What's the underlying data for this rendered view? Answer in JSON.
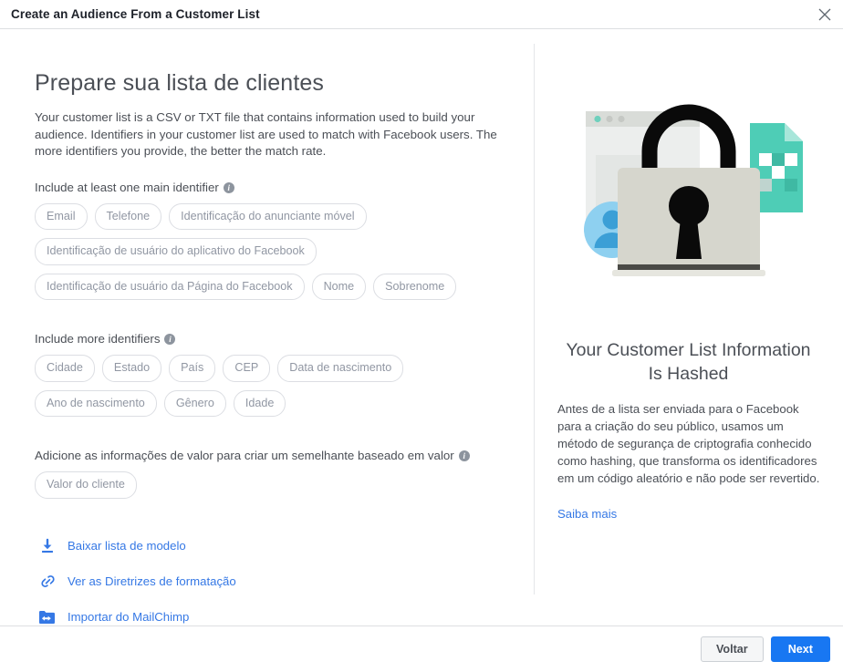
{
  "header": {
    "title": "Create an Audience From a Customer List",
    "close_icon": "close-icon"
  },
  "left": {
    "heading": "Prepare sua lista de clientes",
    "intro": "Your customer list is a CSV or TXT file that contains information used to build your audience. Identifiers in your customer list are used to match with Facebook users. The more identifiers you provide, the better the match rate.",
    "main_identifiers_label": "Include at least one main identifier",
    "main_identifiers": [
      "Email",
      "Telefone",
      "Identificação do anunciante móvel",
      "Identificação de usuário do aplicativo do Facebook",
      "Identificação de usuário da Página do Facebook",
      "Nome",
      "Sobrenome"
    ],
    "more_identifiers_label": "Include more identifiers",
    "more_identifiers": [
      "Cidade",
      "Estado",
      "País",
      "CEP",
      "Data de nascimento",
      "Ano de nascimento",
      "Gênero",
      "Idade"
    ],
    "value_label": "Adicione as informações de valor para criar um semelhante baseado em valor",
    "value_identifiers": [
      "Valor do cliente"
    ],
    "links": [
      {
        "label": "Baixar lista de modelo",
        "icon": "download-icon"
      },
      {
        "label": "Ver as Diretrizes de formatação",
        "icon": "link-chain-icon"
      },
      {
        "label": "Importar do MailChimp",
        "icon": "import-folder-icon"
      }
    ]
  },
  "right": {
    "illustration_name": "padlock-security-illustration",
    "heading": "Your Customer List Information Is Hashed",
    "body": "Antes de a lista ser enviada para o Facebook para a criação do seu público, usamos um método de segurança de criptografia conhecido como hashing, que transforma os identificadores em um código aleatório e não pode ser revertido.",
    "link": "Saiba mais"
  },
  "footer": {
    "back_label": "Voltar",
    "next_label": "Next"
  },
  "colors": {
    "primary": "#1877f2",
    "link": "#3578e5",
    "text": "#4b4f56",
    "chip_text": "#9197a3",
    "border": "#dddfe2"
  }
}
